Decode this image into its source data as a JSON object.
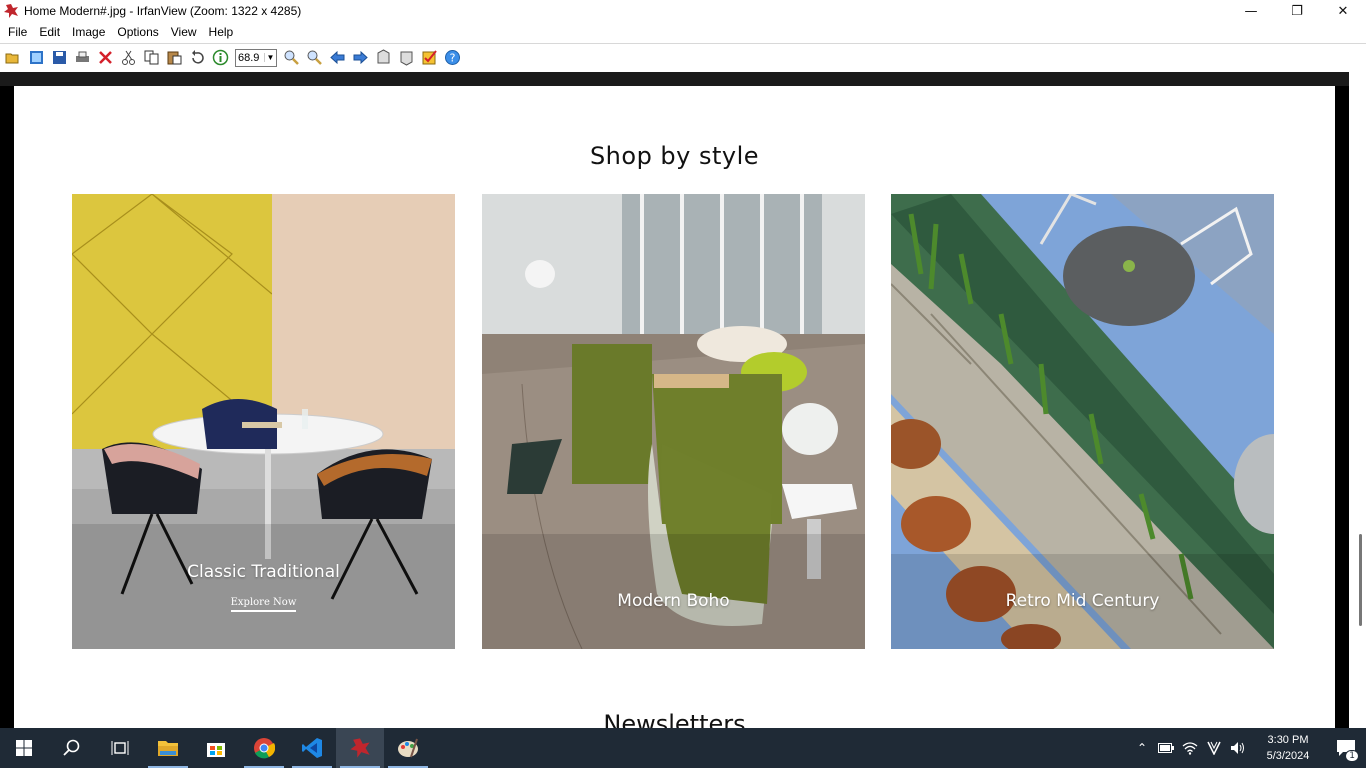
{
  "window": {
    "title": "Home Modern#.jpg - IrfanView (Zoom: 1322 x 4285)",
    "controls": {
      "minimize": "—",
      "restore": "❐",
      "close": "✕"
    }
  },
  "menu": [
    "File",
    "Edit",
    "Image",
    "Options",
    "View",
    "Help"
  ],
  "toolbar": {
    "icons": [
      "open-icon",
      "thumbnails-icon",
      "save-icon",
      "print-icon",
      "delete-icon",
      "cut-icon",
      "copy-icon",
      "paste-icon",
      "undo-icon",
      "info-icon",
      "zoom-in-icon",
      "zoom-out-icon",
      "previous-icon",
      "next-icon",
      "first-icon",
      "last-icon",
      "settings-icon",
      "help-icon"
    ],
    "zoom_value": "68.9"
  },
  "page": {
    "heading": "Shop by style",
    "cards": [
      {
        "label": "Classic Traditional",
        "link": "Explore Now"
      },
      {
        "label": "Modern Boho"
      },
      {
        "label": "Retro Mid Century"
      }
    ],
    "next_heading": "Newsletters"
  },
  "taskbar": {
    "apps": [
      "start-icon",
      "search-icon",
      "task-view-icon",
      "file-explorer-icon",
      "store-icon",
      "chrome-icon",
      "vscode-icon",
      "irfanview-icon",
      "paint-icon"
    ],
    "time": "3:30 PM",
    "date": "5/3/2024",
    "notifications": "1"
  }
}
